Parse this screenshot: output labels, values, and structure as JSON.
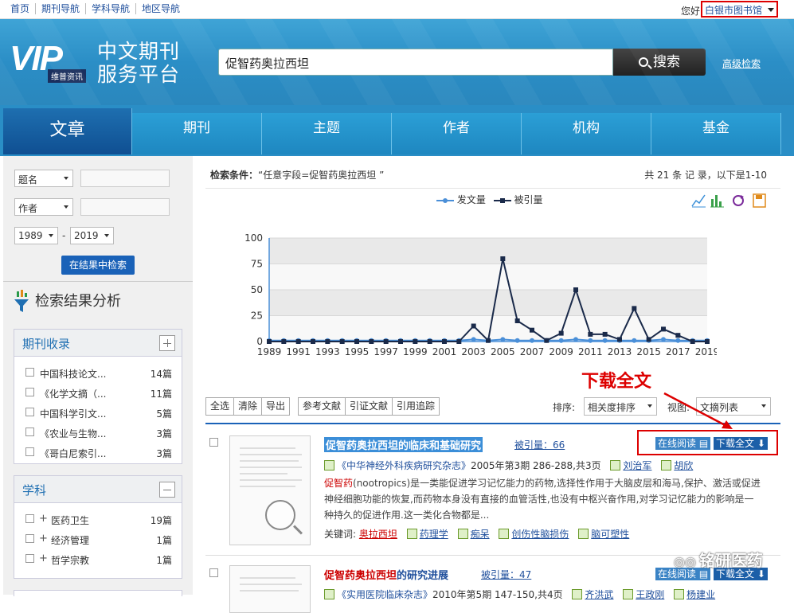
{
  "topnav": {
    "items": [
      "首页",
      "期刊导航",
      "学科导航",
      "地区导航"
    ],
    "hello": "您好",
    "library": "白银市图书馆"
  },
  "header": {
    "logo_text": "VIP",
    "logo_sub": "维普资讯",
    "slogan_line1": "中文期刊",
    "slogan_line2": "服务平台",
    "search_value": "促智药奥拉西坦",
    "search_button": "搜索",
    "advanced": "高级检索"
  },
  "tabs": [
    "文章",
    "期刊",
    "主题",
    "作者",
    "机构",
    "基金"
  ],
  "sidebar": {
    "field1": "题名",
    "field2": "作者",
    "year_from": "1989",
    "year_to": "2019",
    "year_sep": "-",
    "search_in_results": "在结果中检索",
    "analysis_title": "检索结果分析",
    "journals": {
      "title": "期刊收录",
      "items": [
        {
          "label": "中国科技论文...",
          "count": "14篇"
        },
        {
          "label": "《化学文摘（...",
          "count": "11篇"
        },
        {
          "label": "中国科学引文...",
          "count": "5篇"
        },
        {
          "label": "《农业与生物...",
          "count": "3篇"
        },
        {
          "label": "《哥白尼索引...",
          "count": "3篇"
        }
      ]
    },
    "subjects": {
      "title": "学科",
      "items": [
        {
          "label": "医药卫生",
          "count": "19篇"
        },
        {
          "label": "经济管理",
          "count": "1篇"
        },
        {
          "label": "哲学宗教",
          "count": "1篇"
        }
      ]
    }
  },
  "results_header": {
    "condition_label": "检索条件：",
    "condition_value": "“任意字段=促智药奥拉西坦 ”",
    "total": "共 21 条 记 录，以下是1-10"
  },
  "chart_data": {
    "type": "line",
    "x": [
      1989,
      1990,
      1991,
      1992,
      1993,
      1994,
      1995,
      1996,
      1997,
      1998,
      1999,
      2000,
      2001,
      2002,
      2003,
      2004,
      2005,
      2006,
      2007,
      2008,
      2009,
      2010,
      2011,
      2012,
      2013,
      2014,
      2015,
      2016,
      2017,
      2018,
      2019
    ],
    "x_tick_labels": [
      "1989",
      "1991",
      "1993",
      "1995",
      "1997",
      "1999",
      "2001",
      "2003",
      "2005",
      "2007",
      "2009",
      "2011",
      "2013",
      "2015",
      "2017",
      "2019"
    ],
    "series": [
      {
        "name": "发文量",
        "color": "#4a8fd8",
        "values": [
          1,
          1,
          1,
          1,
          1,
          1,
          1,
          1,
          1,
          1,
          1,
          1,
          1,
          1,
          2,
          1,
          2,
          1,
          1,
          1,
          1,
          2,
          1,
          1,
          1,
          1,
          1,
          2,
          1,
          1,
          1
        ]
      },
      {
        "name": "被引量",
        "color": "#1a2a4a",
        "values": [
          0,
          0,
          0,
          0,
          0,
          0,
          0,
          0,
          0,
          0,
          0,
          0,
          0,
          0,
          15,
          1,
          80,
          20,
          11,
          1,
          8,
          50,
          7,
          7,
          2,
          32,
          2,
          12,
          6,
          0,
          0
        ]
      }
    ],
    "ylim": [
      0,
      100
    ],
    "yticks": [
      0,
      25,
      50,
      75,
      100
    ],
    "grid": true,
    "legend": "top-center"
  },
  "toolbar": {
    "group1": [
      "全选",
      "清除",
      "导出"
    ],
    "group2": [
      "参考文献",
      "引证文献",
      "引用追踪"
    ],
    "sort_label": "排序:",
    "sort_value": "相关度排序",
    "view_label": "视图:",
    "view_value": "文摘列表"
  },
  "annotation": "下载全文",
  "results": [
    {
      "title_hl": "促智药奥拉西坦的临床和基础研究",
      "title_rest": "",
      "cited": "被引量：66",
      "read": "在线阅读",
      "download": "下载全文",
      "journal": "《中华神经外科疾病研究杂志》",
      "issue": "2005年第3期 286-288,共3页",
      "authors": [
        "刘治军",
        "胡欣"
      ],
      "abstract_hl": "促智药",
      "abstract": "(nootropics)是一类能促进学习记忆能力的药物,选择性作用于大脑皮层和海马,保护、激活或促进神经细胞功能的恢复,而药物本身没有直接的血管活性,也没有中枢兴奋作用,对学习记忆能力的影响是一种持久的促进作用.这一类化合物都是...",
      "keywords_label": "关键词:",
      "keywords": [
        "奥拉西坦",
        "药理学",
        "痴呆",
        "创伤性脑损伤",
        "脑可塑性"
      ]
    },
    {
      "title_hl": "促智药奥拉西坦",
      "title_rest": "的研究进展",
      "cited": "被引量：47",
      "read": "在线阅读",
      "download": "下载全文",
      "journal": "《实用医院临床杂志》",
      "issue": "2010年第5期 147-150,共4页",
      "authors": [
        "齐洪武",
        "王政刚",
        "杨建业"
      ]
    }
  ],
  "watermark": "铭研医药"
}
